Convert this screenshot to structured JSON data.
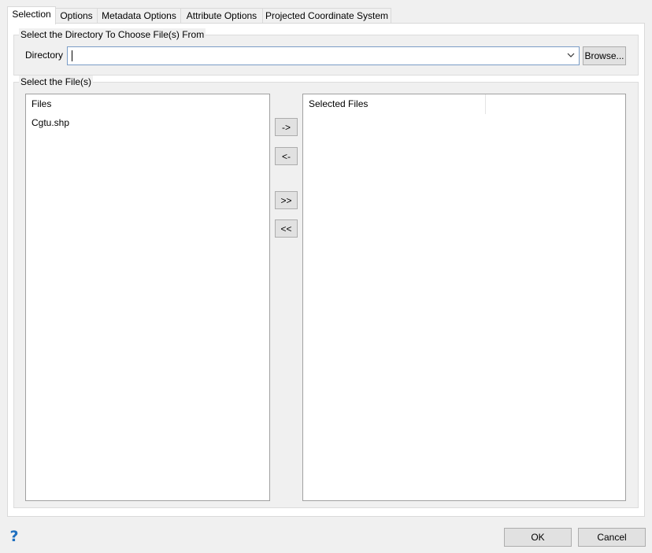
{
  "tabs": [
    {
      "label": "Selection",
      "active": true
    },
    {
      "label": "Options"
    },
    {
      "label": "Metadata Options"
    },
    {
      "label": "Attribute Options"
    },
    {
      "label": "Projected Coordinate System"
    }
  ],
  "directory_group": {
    "title": "Select the Directory To Choose File(s) From",
    "directory_label": "Directory",
    "directory_value": "",
    "browse_label": "Browse..."
  },
  "files_group": {
    "title": "Select the File(s)",
    "available": {
      "header": "Files",
      "items": [
        "Cgtu.shp"
      ]
    },
    "selected": {
      "header": "Selected Files",
      "items": []
    },
    "move_buttons": {
      "add_one": "->",
      "remove_one": "<-",
      "add_all": ">>",
      "remove_all": "<<"
    }
  },
  "footer": {
    "help_icon": "help-question-icon",
    "ok_label": "OK",
    "cancel_label": "Cancel"
  },
  "colors": {
    "help_icon": "#1e6fbf",
    "combo_border": "#7a9cc6"
  }
}
